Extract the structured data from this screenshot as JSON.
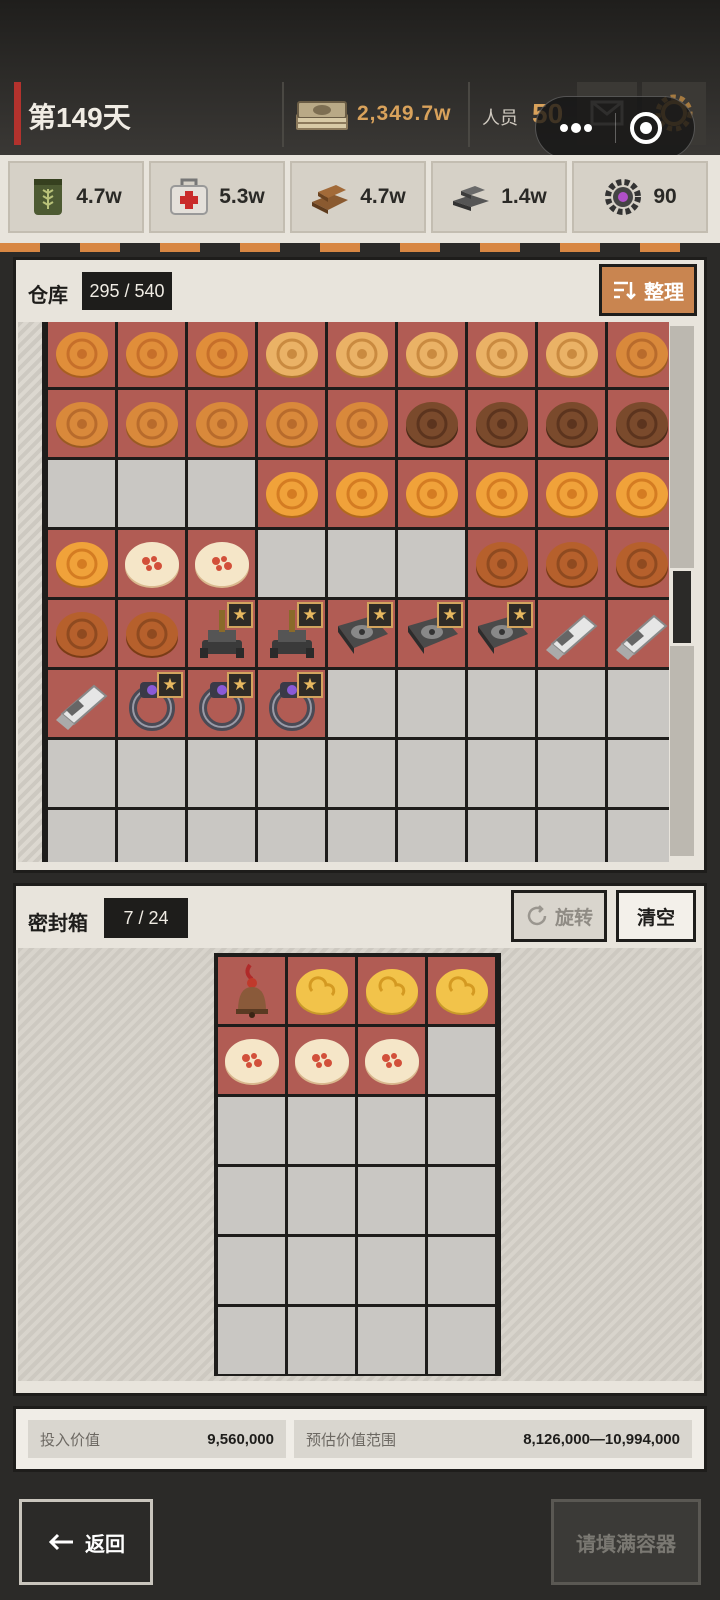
{
  "header": {
    "day": "第149天",
    "cash": "2,349.7w",
    "staff_label": "人员",
    "staff_count": "50"
  },
  "resources": [
    {
      "icon": "grain-sack-icon",
      "value": "4.7w"
    },
    {
      "icon": "medical-kit-icon",
      "value": "5.3w"
    },
    {
      "icon": "wood-planks-icon",
      "value": "4.7w"
    },
    {
      "icon": "steel-ingots-icon",
      "value": "1.4w"
    },
    {
      "icon": "gear-core-icon",
      "value": "90"
    }
  ],
  "warehouse": {
    "title": "仓库",
    "count": "295 / 540",
    "tidy_label": "整理",
    "rows": [
      [
        "mooncake-swirl",
        "mooncake-swirl",
        "mooncake-swirl",
        "mooncake-golden",
        "mooncake-golden",
        "mooncake-golden",
        "mooncake-golden",
        "mooncake-golden",
        "mooncake-flower"
      ],
      [
        "mooncake-flower",
        "mooncake-flower",
        "mooncake-flower",
        "mooncake-flower",
        "mooncake-flower",
        "mooncake-dark",
        "mooncake-dark",
        "mooncake-dark",
        "mooncake-dark"
      ],
      [
        "empty",
        "empty",
        "empty",
        "mooncake-sun",
        "mooncake-sun",
        "mooncake-sun",
        "mooncake-sun",
        "mooncake-sun",
        "mooncake-sun"
      ],
      [
        "mooncake-sun",
        "pastry-white",
        "pastry-white",
        "empty",
        "empty",
        "empty",
        "mooncake-brown",
        "mooncake-brown",
        "mooncake-brown"
      ],
      [
        "mooncake-brown",
        "mooncake-brown",
        "turret-star",
        "turret-star",
        "hdd-star",
        "hdd-star",
        "hdd-star",
        "usb-drive",
        "usb-drive"
      ],
      [
        "usb-drive",
        "ring-star",
        "ring-star",
        "ring-star",
        "empty",
        "empty",
        "empty",
        "empty",
        "empty"
      ],
      [
        "empty",
        "empty",
        "empty",
        "empty",
        "empty",
        "empty",
        "empty",
        "empty",
        "empty"
      ],
      [
        "empty",
        "empty",
        "empty",
        "empty",
        "empty",
        "empty",
        "empty",
        "empty",
        "empty"
      ]
    ]
  },
  "sealed_box": {
    "title": "密封箱",
    "count": "7 / 24",
    "rotate_label": "旋转",
    "clear_label": "清空",
    "rows": [
      [
        "bell",
        "mooncake-cloud",
        "mooncake-cloud",
        "mooncake-cloud"
      ],
      [
        "pastry-white",
        "pastry-white",
        "pastry-white",
        "empty"
      ],
      [
        "empty",
        "empty",
        "empty",
        "empty"
      ],
      [
        "empty",
        "empty",
        "empty",
        "empty"
      ],
      [
        "empty",
        "empty",
        "empty",
        "empty"
      ],
      [
        "empty",
        "empty",
        "empty",
        "empty"
      ]
    ]
  },
  "values": {
    "invest_label": "投入价值",
    "invest_value": "9,560,000",
    "estimate_label": "预估价值范围",
    "estimate_value": "8,126,000—10,994,000"
  },
  "footer": {
    "back_label": "返回",
    "fill_label": "请填满容器"
  },
  "colors": {
    "accent": "#d88743",
    "cell_filled": "#b15c54",
    "cell_empty": "#c9c7c3",
    "gold_text": "#d9a25b"
  }
}
